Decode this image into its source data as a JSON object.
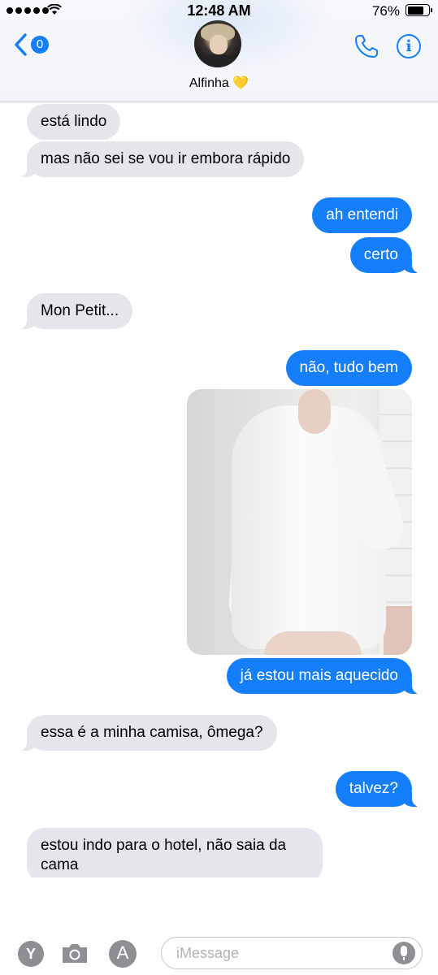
{
  "status_bar": {
    "time": "12:48 AM",
    "battery": "76%",
    "battery_level": 0.76
  },
  "header": {
    "back_count": "0",
    "contact_name": "Alfinha",
    "contact_emoji": "💛",
    "icons": [
      "chevron-left-icon",
      "phone-icon",
      "info-icon"
    ],
    "accent_color": "#147efb"
  },
  "messages": [
    {
      "side": "in",
      "text": "está lindo"
    },
    {
      "side": "in",
      "text": "mas não sei se vou ir embora rápido"
    },
    {
      "side": "out",
      "text": "ah entendi"
    },
    {
      "side": "out",
      "text": "certo"
    },
    {
      "side": "in",
      "text": "Mon Petit..."
    },
    {
      "side": "out",
      "text": "não, tudo bem"
    },
    {
      "side": "out",
      "type": "photo"
    },
    {
      "side": "out",
      "text": "já estou mais aquecido"
    },
    {
      "side": "in",
      "text": "essa é a minha camisa, ômega?"
    },
    {
      "side": "out",
      "text": "talvez?"
    },
    {
      "side": "in",
      "text": "estou indo para o hotel, não saia da cama"
    }
  ],
  "input_bar": {
    "placeholder": "iMessage",
    "y_label": "Y",
    "appstore_label": "A",
    "icons": [
      "camera-icon",
      "app-store-icon",
      "microphone-icon"
    ]
  },
  "colors": {
    "incoming_bubble": "#e6e5eb",
    "outgoing_bubble": "#147efb"
  }
}
